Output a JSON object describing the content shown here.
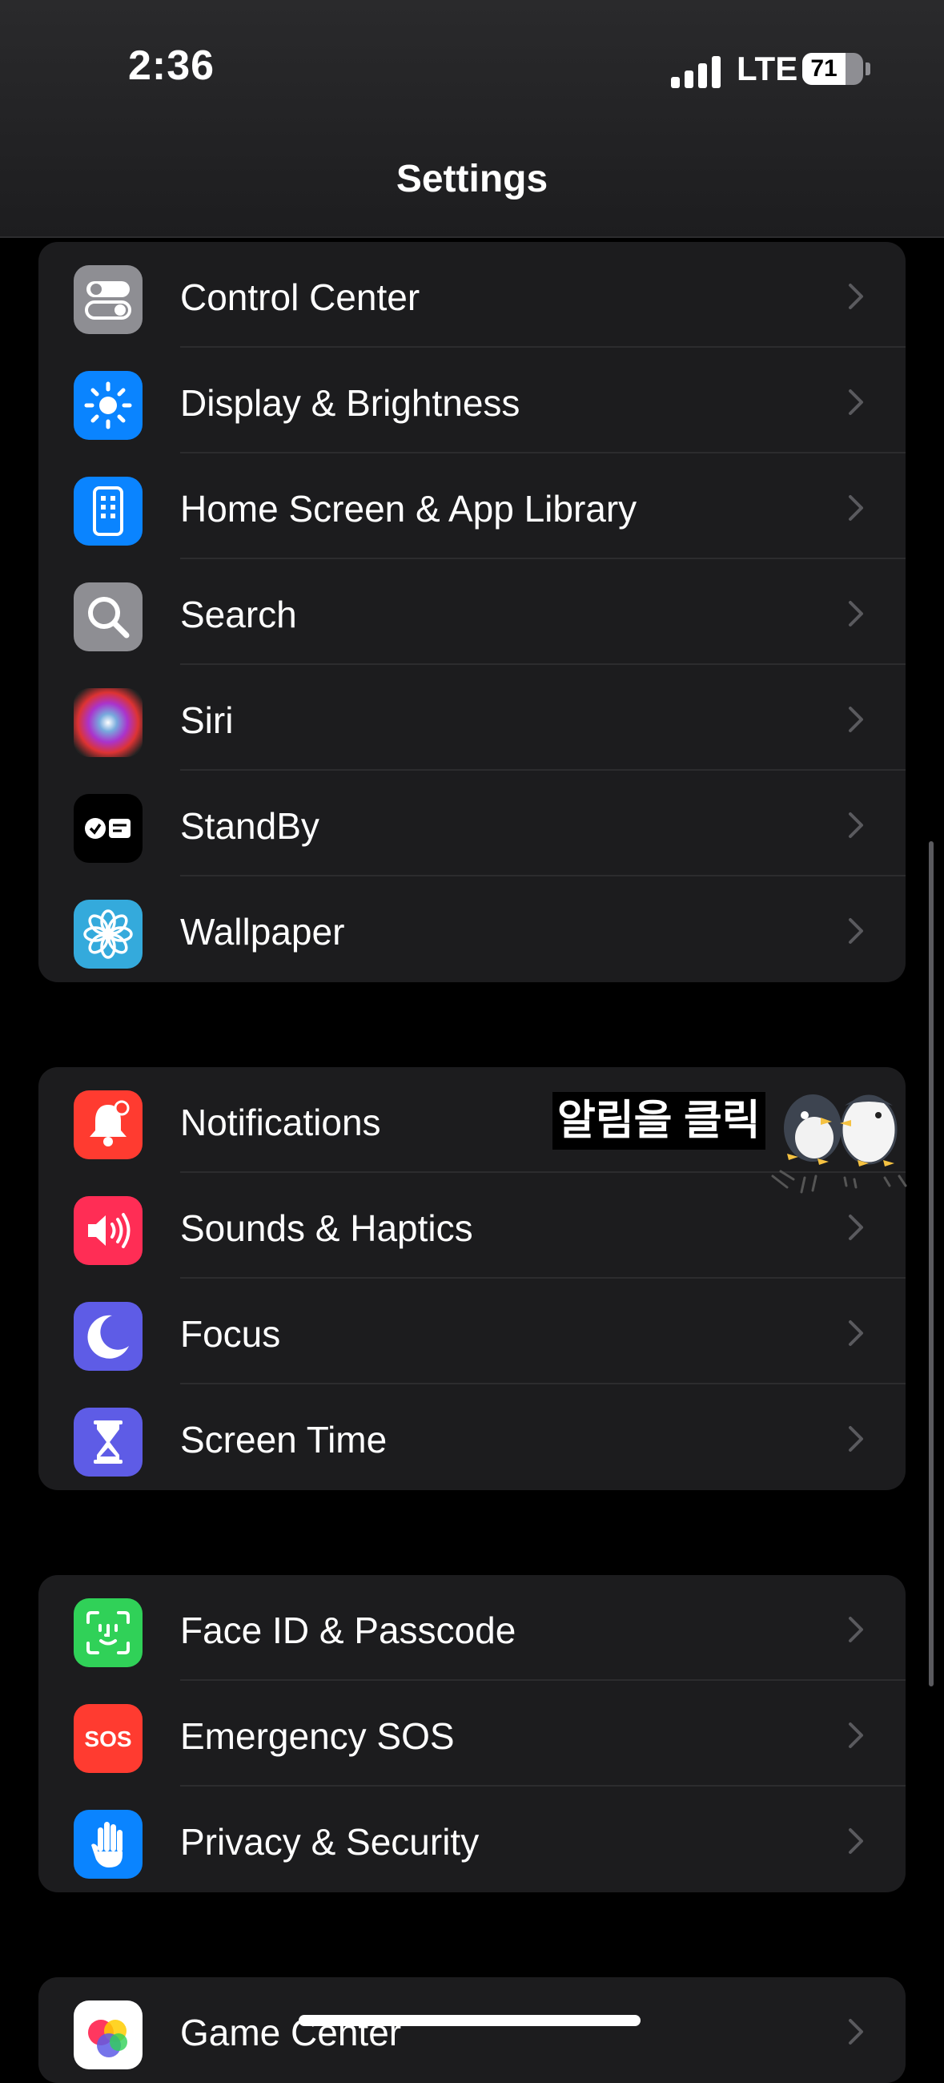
{
  "status": {
    "time": "2:36",
    "network": "LTE",
    "battery": "71"
  },
  "header": {
    "title": "Settings"
  },
  "groups": [
    {
      "items": [
        {
          "label": "Control Center",
          "icon": "toggles-icon",
          "color": "#8e8e93"
        },
        {
          "label": "Display & Brightness",
          "icon": "sun-icon",
          "color": "#0a84ff"
        },
        {
          "label": "Home Screen & App Library",
          "icon": "phone-grid-icon",
          "color": "#0a84ff"
        },
        {
          "label": "Search",
          "icon": "magnifier-icon",
          "color": "#8e8e93"
        },
        {
          "label": "Siri",
          "icon": "siri-icon",
          "color": "#1a1a2e"
        },
        {
          "label": "StandBy",
          "icon": "standby-icon",
          "color": "#000000"
        },
        {
          "label": "Wallpaper",
          "icon": "flower-icon",
          "color": "#34aadc"
        }
      ]
    },
    {
      "items": [
        {
          "label": "Notifications",
          "icon": "bell-icon",
          "color": "#ff3b30"
        },
        {
          "label": "Sounds & Haptics",
          "icon": "speaker-icon",
          "color": "#ff2d55"
        },
        {
          "label": "Focus",
          "icon": "moon-icon",
          "color": "#5e5ce6"
        },
        {
          "label": "Screen Time",
          "icon": "hourglass-icon",
          "color": "#5e5ce6"
        }
      ]
    },
    {
      "items": [
        {
          "label": "Face ID & Passcode",
          "icon": "faceid-icon",
          "color": "#30d158"
        },
        {
          "label": "Emergency SOS",
          "icon": "sos-icon",
          "color": "#ff3b30"
        },
        {
          "label": "Privacy & Security",
          "icon": "hand-icon",
          "color": "#0a84ff"
        }
      ]
    },
    {
      "items": [
        {
          "label": "Game Center",
          "icon": "game-center-icon",
          "color": "#ffffff"
        }
      ]
    }
  ],
  "overlay": {
    "callout_text": "알림을 클릭"
  }
}
